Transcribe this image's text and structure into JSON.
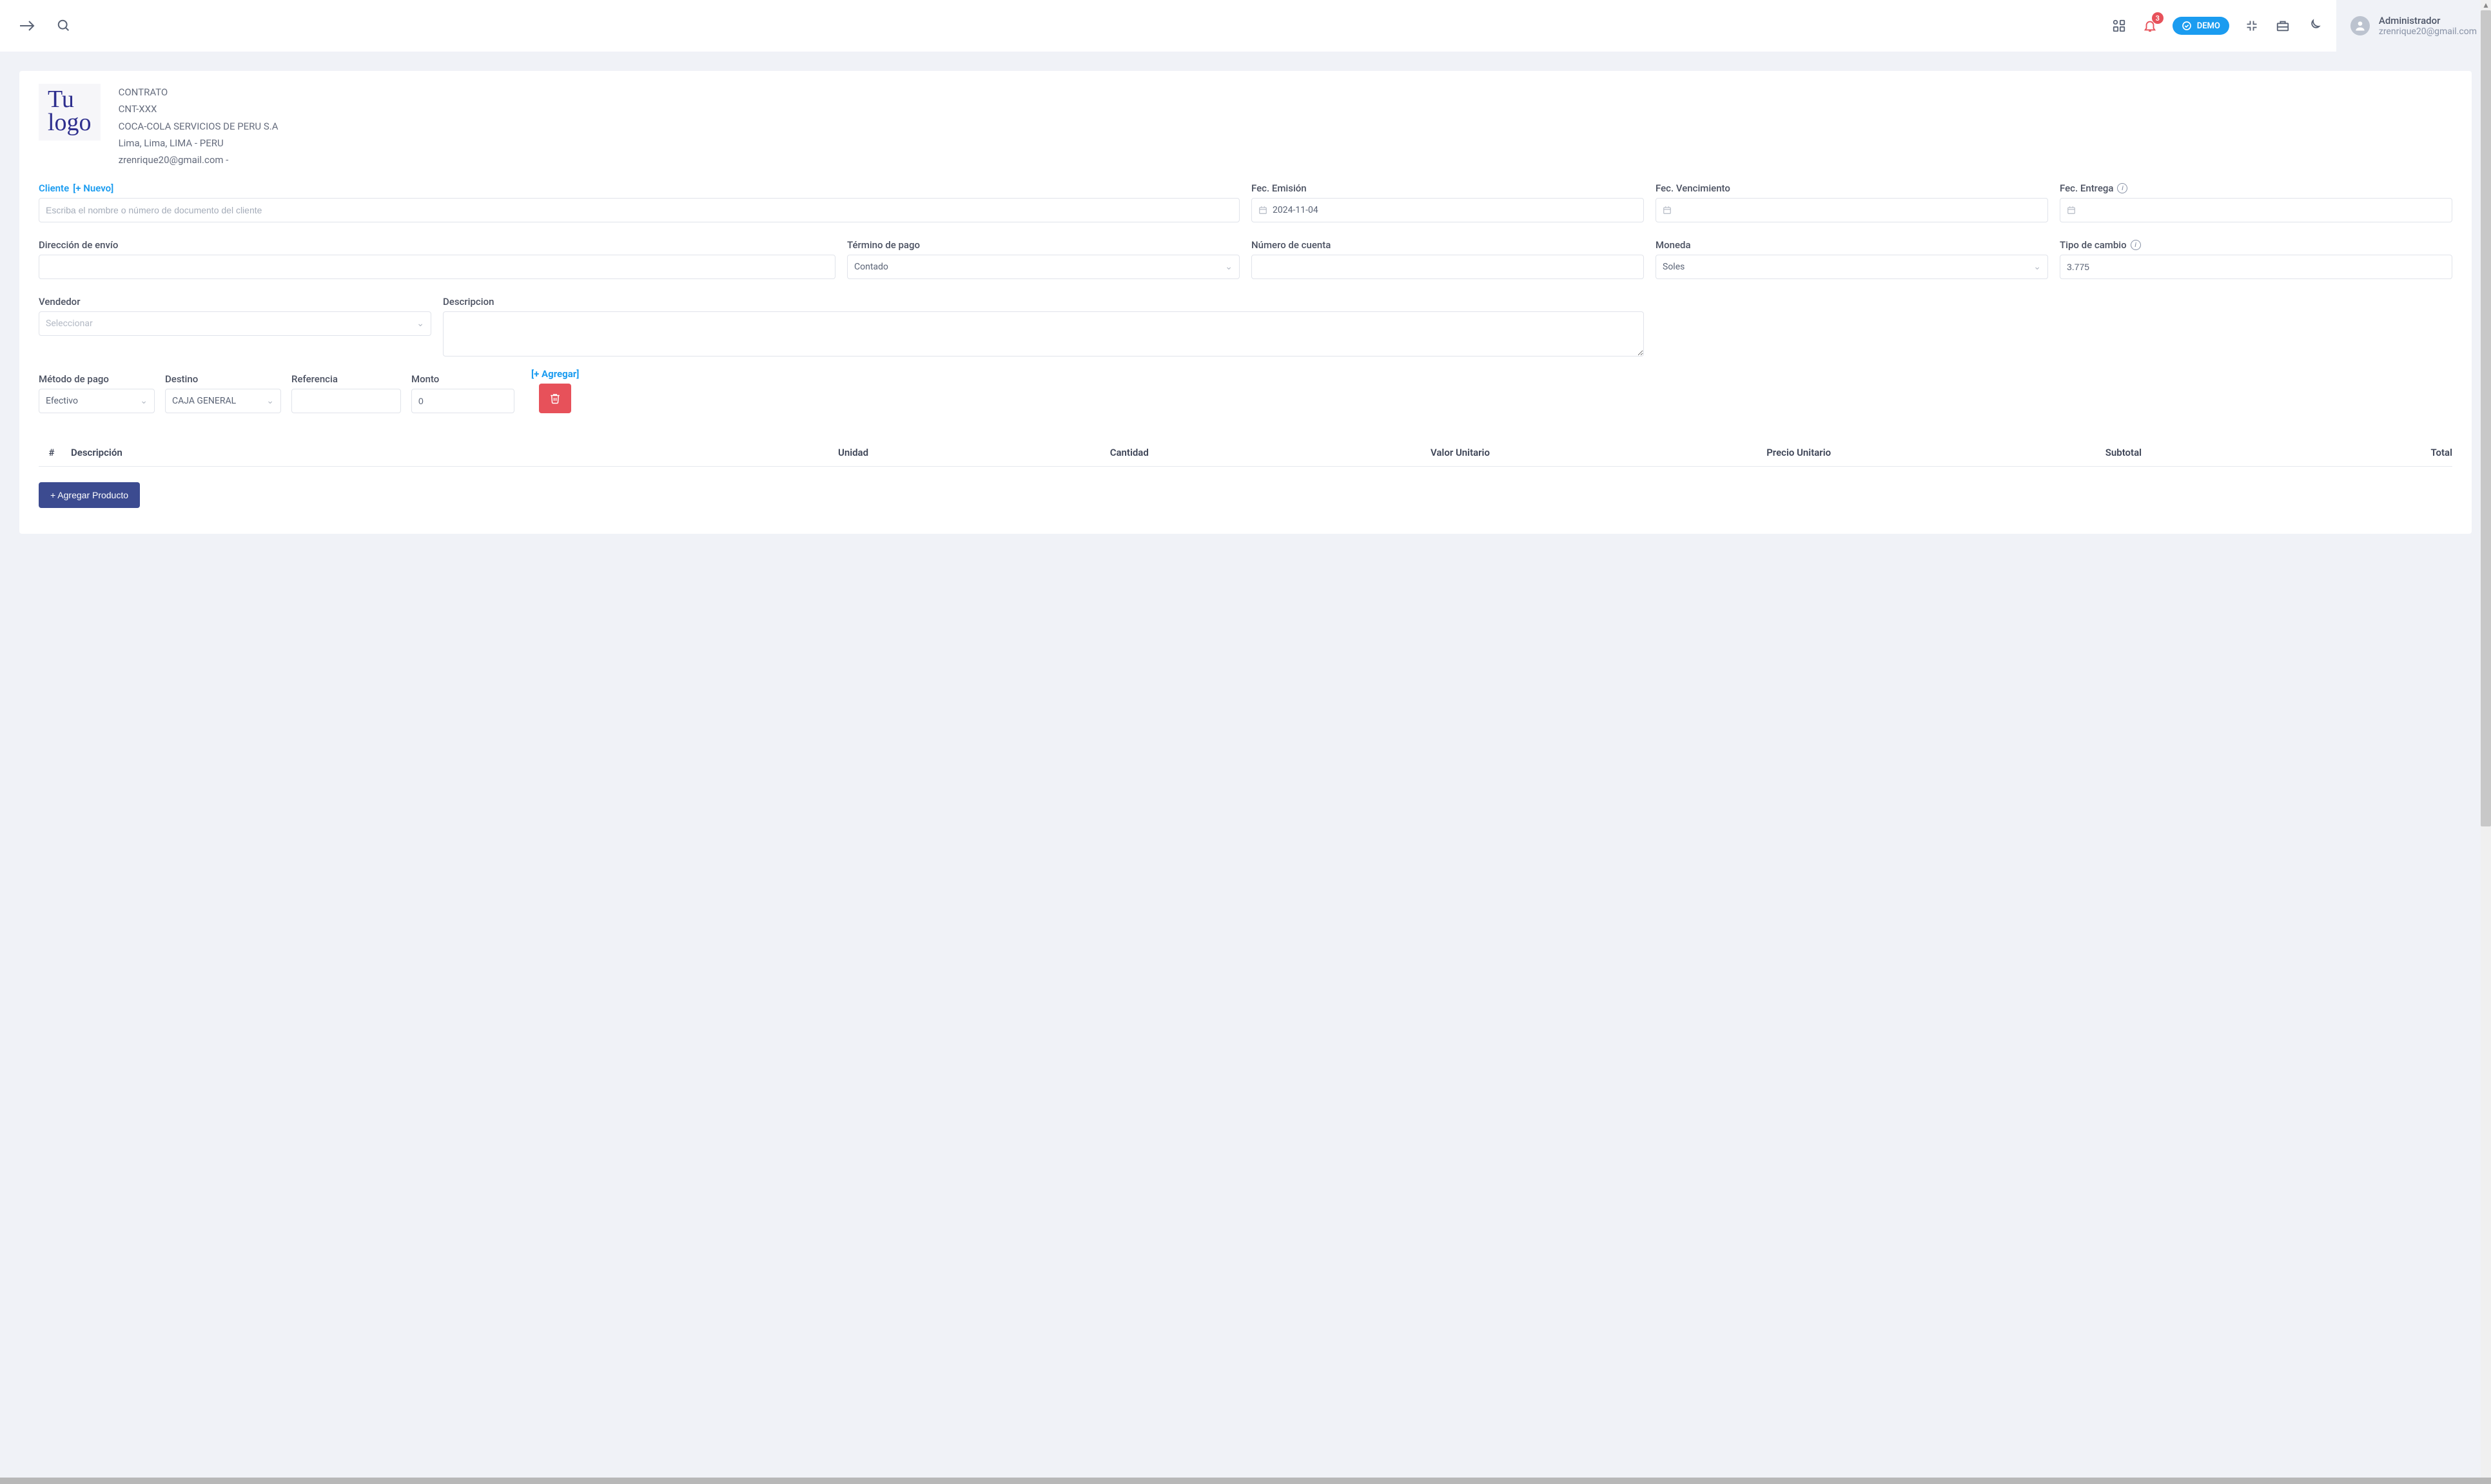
{
  "topbar": {
    "notification_count": "3",
    "demo_label": "DEMO",
    "user_name": "Administrador",
    "user_email": "zrenrique20@gmail.com"
  },
  "document": {
    "logo_line1": "Tu",
    "logo_line2": "logo",
    "type": "CONTRATO",
    "code": "CNT-XXX",
    "company": "COCA-COLA SERVICIOS DE PERU S.A",
    "location": "Lima, Lima, LIMA - PERU",
    "email_line": "zrenrique20@gmail.com -"
  },
  "form": {
    "client_label": "Cliente",
    "client_new": "[+ Nuevo]",
    "client_placeholder": "Escriba el nombre o número de documento del cliente",
    "emission_label": "Fec. Emisión",
    "emission_value": "2024-11-04",
    "due_label": "Fec. Vencimiento",
    "delivery_label": "Fec. Entrega",
    "ship_address_label": "Dirección de envío",
    "payment_term_label": "Término de pago",
    "payment_term_value": "Contado",
    "account_label": "Número de cuenta",
    "currency_label": "Moneda",
    "currency_value": "Soles",
    "exchange_label": "Tipo de cambio",
    "exchange_value": "3.775",
    "seller_label": "Vendedor",
    "seller_placeholder": "Seleccionar",
    "description_label": "Descripcion"
  },
  "payment": {
    "method_label": "Método de pago",
    "method_value": "Efectivo",
    "dest_label": "Destino",
    "dest_value": "CAJA GENERAL",
    "ref_label": "Referencia",
    "amount_label": "Monto",
    "amount_value": "0",
    "add_label": "[+ Agregar]"
  },
  "table": {
    "h_num": "#",
    "h_desc": "Descripción",
    "h_unit": "Unidad",
    "h_qty": "Cantidad",
    "h_val": "Valor Unitario",
    "h_price": "Precio Unitario",
    "h_sub": "Subtotal",
    "h_total": "Total",
    "add_product": "+ Agregar Producto"
  }
}
